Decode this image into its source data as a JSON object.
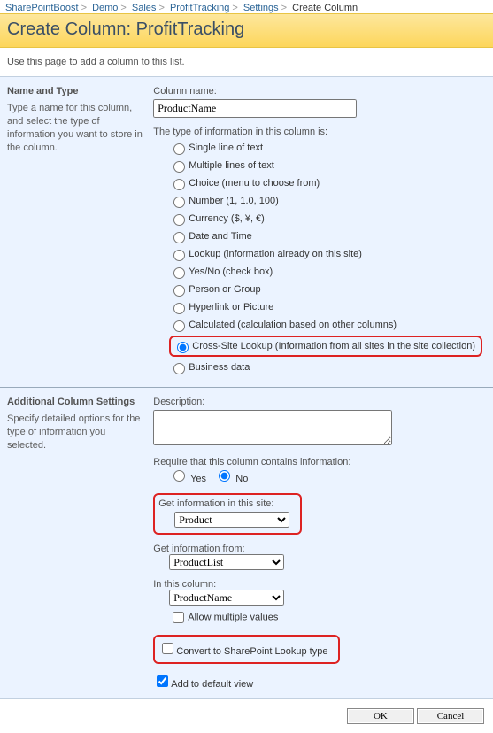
{
  "breadcrumb": [
    "SharePointBoost",
    "Demo",
    "Sales",
    "ProfitTracking",
    "Settings",
    "Create Column"
  ],
  "page_title": "Create Column: ProfitTracking",
  "page_desc": "Use this page to add a column to this list.",
  "section1": {
    "heading": "Name and Type",
    "sub": "Type a name for this column, and select the type of information you want to store in the column.",
    "col_name_label": "Column name:",
    "col_name_value": "ProductName",
    "type_label": "The type of information in this column is:",
    "types": [
      "Single line of text",
      "Multiple lines of text",
      "Choice (menu to choose from)",
      "Number (1, 1.0, 100)",
      "Currency ($, ¥, €)",
      "Date and Time",
      "Lookup (information already on this site)",
      "Yes/No (check box)",
      "Person or Group",
      "Hyperlink or Picture",
      "Calculated (calculation based on other columns)",
      "Cross-Site Lookup (Information from all sites in the site collection)",
      "Business data"
    ],
    "selected_type_index": 11
  },
  "section2": {
    "heading": "Additional Column Settings",
    "sub": "Specify detailed options for the type of information you selected.",
    "desc_label": "Description:",
    "desc_value": "",
    "require_label": "Require that this column contains information:",
    "require_yes": "Yes",
    "require_no": "No",
    "require_selected": "No",
    "get_site_label": "Get information in this site:",
    "get_site_value": "Product",
    "get_from_label": "Get information from:",
    "get_from_value": "ProductList",
    "in_column_label": "In this column:",
    "in_column_value": "ProductName",
    "allow_multi_label": "Allow multiple values",
    "allow_multi_checked": false,
    "convert_label": "Convert to SharePoint Lookup type",
    "convert_checked": false,
    "add_default_label": "Add to default view",
    "add_default_checked": true
  },
  "buttons": {
    "ok": "OK",
    "cancel": "Cancel"
  }
}
